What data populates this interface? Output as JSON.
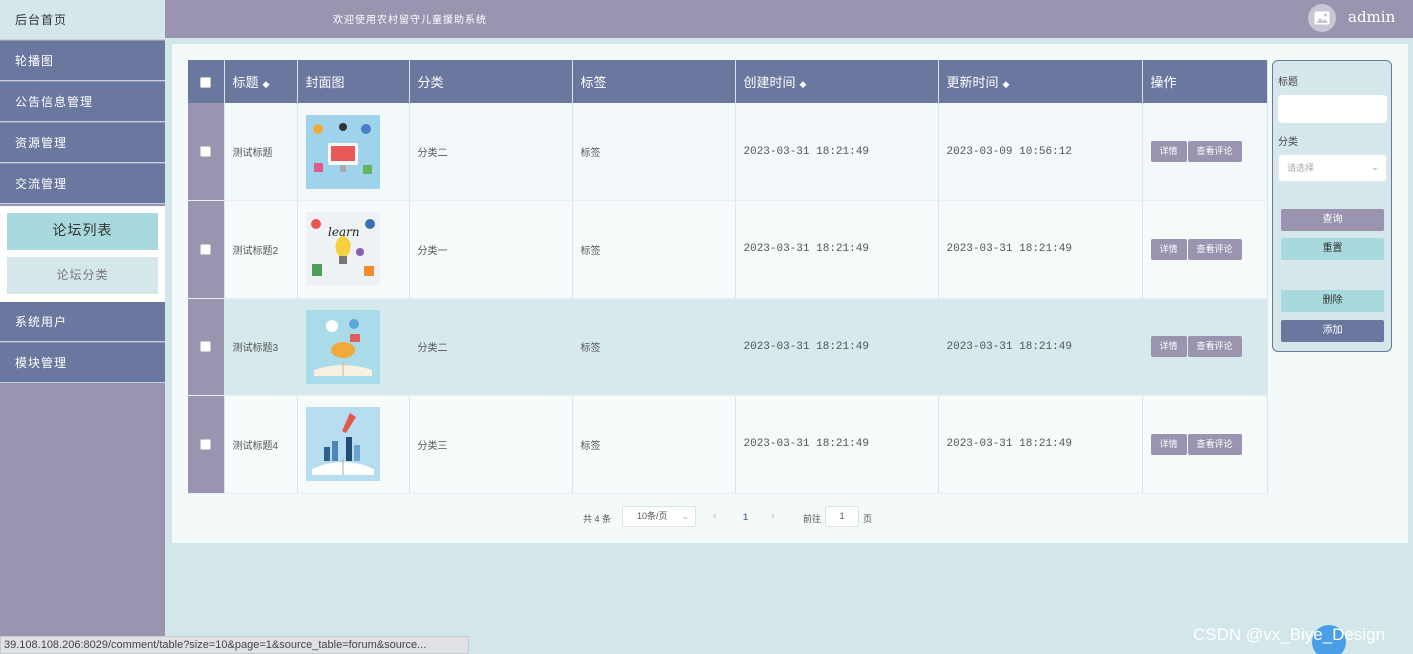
{
  "header": {
    "title": "欢迎使用农村留守儿童援助系统",
    "username": "admin"
  },
  "sidebar": {
    "home": "后台首页",
    "items": [
      "轮播图",
      "公告信息管理",
      "资源管理",
      "交流管理"
    ],
    "sub_items": {
      "active": "论坛列表",
      "other": "论坛分类"
    },
    "items_after": [
      "系统用户",
      "模块管理"
    ]
  },
  "table": {
    "columns": {
      "title": "标题",
      "cover": "封面图",
      "category": "分类",
      "tag": "标签",
      "created": "创建时间",
      "updated": "更新时间",
      "actions": "操作"
    },
    "rows": [
      {
        "title": "测试标题",
        "category": "分类二",
        "tag": "标签",
        "created": "2023-03-31 18:21:49",
        "updated": "2023-03-09 10:56:12"
      },
      {
        "title": "测试标题2",
        "category": "分类一",
        "tag": "标签",
        "created": "2023-03-31 18:21:49",
        "updated": "2023-03-31 18:21:49"
      },
      {
        "title": "测试标题3",
        "category": "分类二",
        "tag": "标签",
        "created": "2023-03-31 18:21:49",
        "updated": "2023-03-31 18:21:49"
      },
      {
        "title": "测试标题4",
        "category": "分类三",
        "tag": "标签",
        "created": "2023-03-31 18:21:49",
        "updated": "2023-03-31 18:21:49"
      }
    ],
    "detail_label": "详情",
    "comment_label": "查看评论"
  },
  "filter": {
    "title_label": "标题",
    "category_label": "分类",
    "category_placeholder": "请选择",
    "search_label": "查询",
    "reset_label": "重置",
    "delete_label": "删除",
    "add_label": "添加"
  },
  "pagination": {
    "total": "共 4 条",
    "page_size": "10条/页",
    "current_page": "1",
    "goto_label": "前往",
    "goto_value": "1",
    "page_suffix": "页"
  },
  "statusbar": {
    "url": "39.108.108.206:8029/comment/table?size=10&page=1&source_table=forum&source..."
  },
  "watermark": "CSDN @vx_Biye_Design",
  "colors": {
    "primary": "#6a779e",
    "lavender": "#9a94b1",
    "light_teal": "#a8d9df",
    "bg": "#d3e7ea"
  }
}
